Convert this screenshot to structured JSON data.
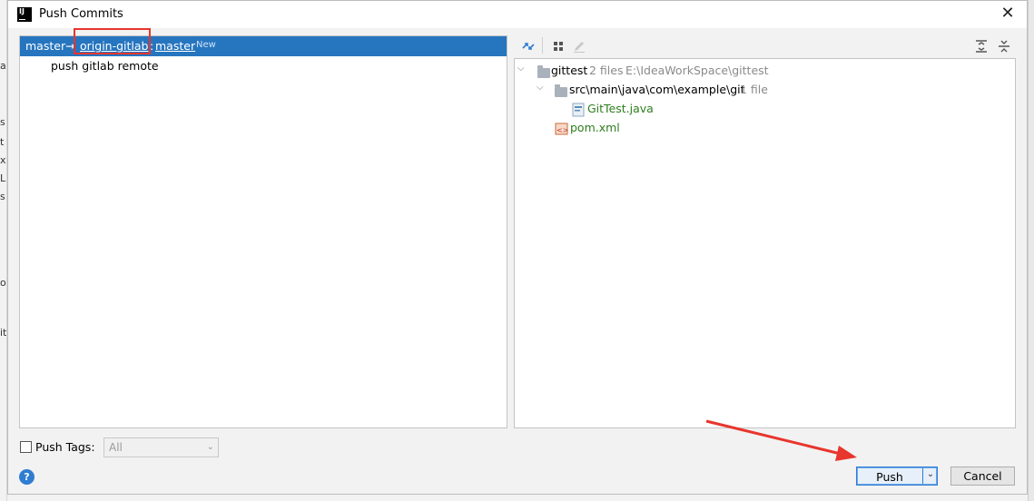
{
  "ide_left_fragments": [
    "a",
    "s",
    "t",
    "x",
    "Li",
    "s",
    "ol",
    "it"
  ],
  "dialog": {
    "title": "Push Commits",
    "close_icon": "close-icon"
  },
  "left_panel": {
    "branch_local": "master",
    "arrow_symbol": "→",
    "remote": "origin-gitlab",
    "colon": ":",
    "branch_remote": "master",
    "new_badge": "New",
    "commit_message": "push gitlab remote"
  },
  "toolbar": {
    "icons": [
      "collapse-arrows-icon",
      "group-by-icon",
      "edit-icon",
      "expand-all-icon",
      "collapse-all-icon"
    ]
  },
  "tree": {
    "root_name": "gittest",
    "root_count": "2 files",
    "root_path": "E:\\IdeaWorkSpace\\gittest",
    "folder_name": "src\\main\\java\\com\\example\\git",
    "folder_count": "1 file",
    "file1": "GitTest.java",
    "file2": "pom.xml"
  },
  "bottom": {
    "push_tags_label": "Push Tags:",
    "push_tags_select": "All",
    "help": "?",
    "push_button": "Push",
    "cancel_button": "Cancel"
  },
  "colors": {
    "selection": "#2675bf",
    "annotation_red": "#e8352d",
    "modified_green": "#2e7d1e"
  }
}
